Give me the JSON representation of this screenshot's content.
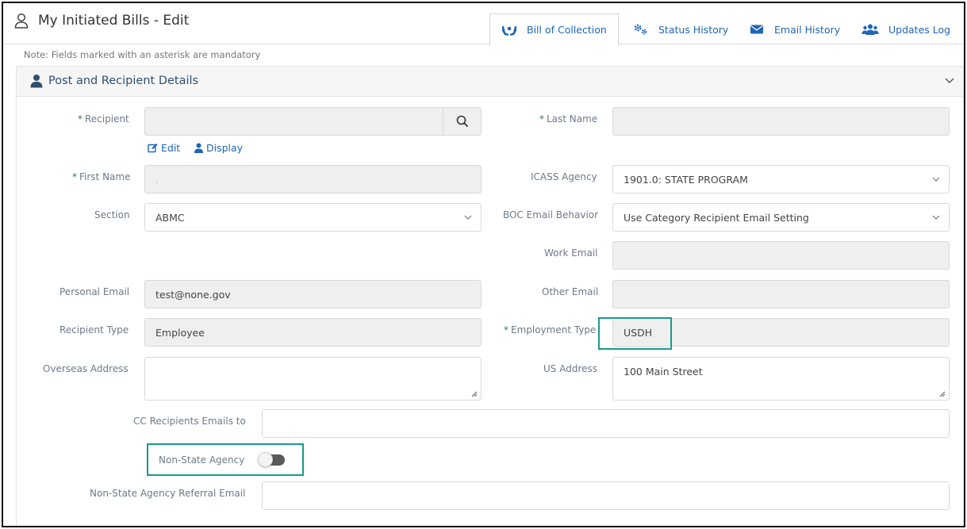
{
  "header": {
    "title": "My Initiated Bills - Edit",
    "tabs": [
      {
        "label": "Bill of Collection",
        "icon": "hands-icon",
        "active": true
      },
      {
        "label": "Status History",
        "icon": "gears-icon",
        "active": false
      },
      {
        "label": "Email History",
        "icon": "envelope-icon",
        "active": false
      },
      {
        "label": "Updates Log",
        "icon": "users-icon",
        "active": false
      }
    ]
  },
  "note": "Note: Fields marked with an asterisk are mandatory",
  "panel": {
    "title": "Post and Recipient Details"
  },
  "form": {
    "recipient": {
      "label": "Recipient",
      "value": ""
    },
    "edit_link": "Edit",
    "display_link": "Display",
    "last_name": {
      "label": "Last Name",
      "value": ""
    },
    "first_name": {
      "label": "First Name",
      "value": "."
    },
    "icass_agency": {
      "label": "ICASS Agency",
      "value": "1901.0: STATE PROGRAM"
    },
    "section": {
      "label": "Section",
      "value": "ABMC"
    },
    "boc_email_behavior": {
      "label": "BOC Email Behavior",
      "value": "Use Category Recipient Email Setting"
    },
    "work_email": {
      "label": "Work Email",
      "value": ""
    },
    "personal_email": {
      "label": "Personal Email",
      "value": "test@none.gov"
    },
    "other_email": {
      "label": "Other Email",
      "value": ""
    },
    "recipient_type": {
      "label": "Recipient Type",
      "value": "Employee"
    },
    "employment_type": {
      "label": "Employment Type",
      "value": "USDH"
    },
    "overseas_address": {
      "label": "Overseas Address",
      "value": ""
    },
    "us_address": {
      "label": "US Address",
      "value": "100 Main Street"
    },
    "cc_recipients": {
      "label": "CC Recipients Emails to",
      "value": ""
    },
    "non_state_agency": {
      "label": "Non-State Agency",
      "checked": false
    },
    "non_state_referral": {
      "label": "Non-State Agency Referral Email",
      "value": ""
    }
  },
  "colors": {
    "accent": "#1f66b5",
    "highlight": "#1a9a8a",
    "required": "#2e7d5b"
  }
}
